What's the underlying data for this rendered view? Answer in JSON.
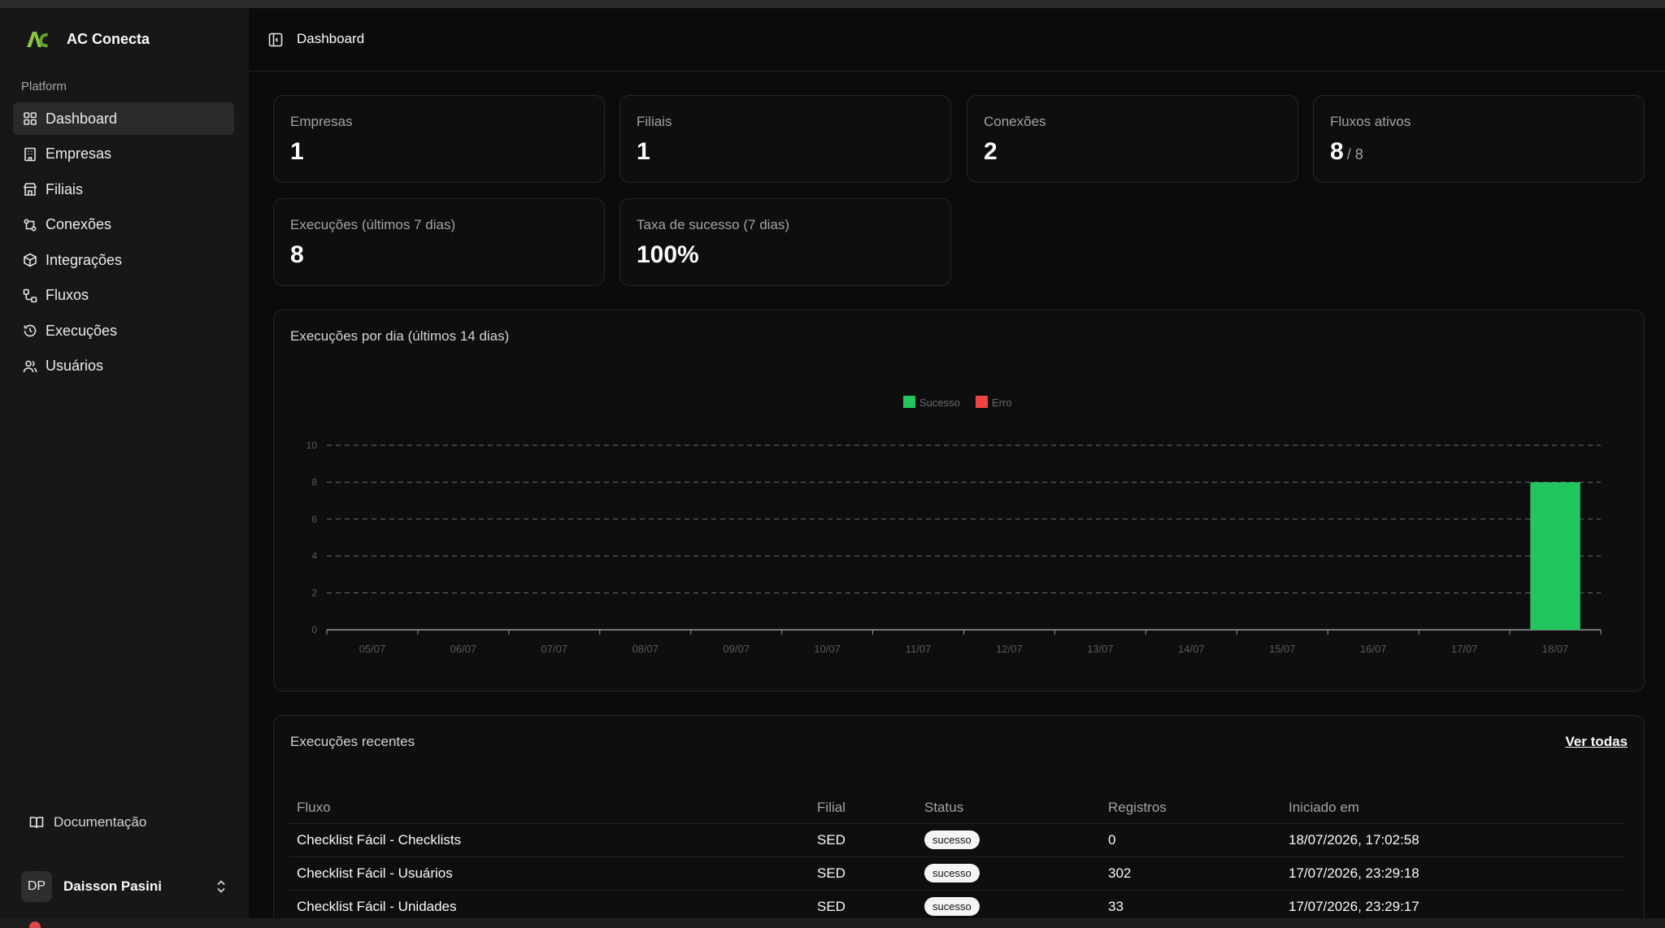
{
  "app": {
    "name": "AC Conecta",
    "logo_text": "AC"
  },
  "sidebar": {
    "group_label": "Platform",
    "items": [
      {
        "label": "Dashboard",
        "icon": "dashboard-grid-icon",
        "active": true
      },
      {
        "label": "Empresas",
        "icon": "building-icon"
      },
      {
        "label": "Filiais",
        "icon": "store-icon"
      },
      {
        "label": "Conexões",
        "icon": "connection-icon"
      },
      {
        "label": "Integrações",
        "icon": "package-icon"
      },
      {
        "label": "Fluxos",
        "icon": "workflow-icon"
      },
      {
        "label": "Execuções",
        "icon": "history-icon"
      },
      {
        "label": "Usuários",
        "icon": "users-icon"
      }
    ],
    "docs_label": "Documentação",
    "user": {
      "initials": "DP",
      "name": "Daisson Pasini"
    }
  },
  "header": {
    "title": "Dashboard"
  },
  "stats": {
    "empresas": {
      "label": "Empresas",
      "value": "1"
    },
    "filiais": {
      "label": "Filiais",
      "value": "1"
    },
    "conexoes": {
      "label": "Conexões",
      "value": "2"
    },
    "fluxos": {
      "label": "Fluxos ativos",
      "value": "8",
      "sub": "/ 8"
    },
    "execucoes": {
      "label": "Execuções (últimos 7 dias)",
      "value": "8"
    },
    "taxa": {
      "label": "Taxa de sucesso (7 dias)",
      "value": "100%"
    }
  },
  "chart_title": "Execuções por dia (últimos 14 dias)",
  "chart_data": {
    "type": "bar",
    "stacked": true,
    "categories": [
      "05/07",
      "06/07",
      "07/07",
      "08/07",
      "09/07",
      "10/07",
      "11/07",
      "12/07",
      "13/07",
      "14/07",
      "15/07",
      "16/07",
      "17/07",
      "18/07"
    ],
    "series": [
      {
        "name": "Sucesso",
        "color": "#22c55e",
        "values": [
          0,
          0,
          0,
          0,
          0,
          0,
          0,
          0,
          0,
          0,
          0,
          0,
          0,
          8
        ]
      },
      {
        "name": "Erro",
        "color": "#ef4444",
        "values": [
          0,
          0,
          0,
          0,
          0,
          0,
          0,
          0,
          0,
          0,
          0,
          0,
          0,
          0
        ]
      }
    ],
    "yticks": [
      0,
      2,
      4,
      6,
      8,
      10
    ],
    "ylim": [
      0,
      10
    ],
    "grid": true,
    "legend": "top-center"
  },
  "recent": {
    "title": "Execuções recentes",
    "see_all": "Ver todas",
    "columns": [
      "Fluxo",
      "Filial",
      "Status",
      "Registros",
      "Iniciado em"
    ],
    "rows": [
      {
        "fluxo": "Checklist Fácil - Checklists",
        "filial": "SED",
        "status": "sucesso",
        "registros": "0",
        "iniciado": "18/07/2026, 17:02:58"
      },
      {
        "fluxo": "Checklist Fácil - Usuários",
        "filial": "SED",
        "status": "sucesso",
        "registros": "302",
        "iniciado": "17/07/2026, 23:29:18"
      },
      {
        "fluxo": "Checklist Fácil - Unidades",
        "filial": "SED",
        "status": "sucesso",
        "registros": "33",
        "iniciado": "17/07/2026, 23:29:17"
      }
    ]
  },
  "colors": {
    "accent_green": "#22c55e",
    "error_red": "#ef4444"
  }
}
